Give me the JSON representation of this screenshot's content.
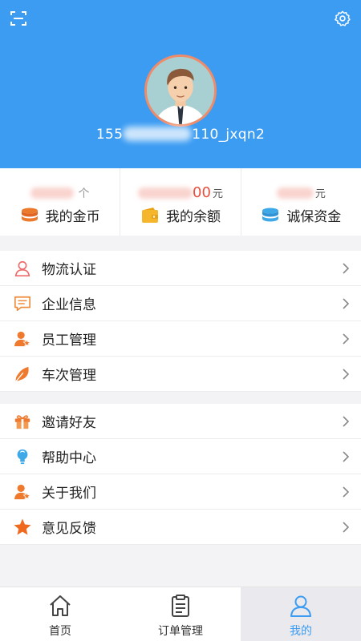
{
  "header": {
    "username_prefix": "155",
    "username_suffix": "110_jxqn2",
    "accent": "#3b9cf2"
  },
  "stats": [
    {
      "label": "我的金币",
      "value_tail": "个",
      "icon": "coin-stack-icon"
    },
    {
      "label": "我的余额",
      "value_tail": "00",
      "unit": "元",
      "icon": "wallet-icon"
    },
    {
      "label": "诚保资金",
      "value_tail": "0.00",
      "unit": "元",
      "icon": "database-icon"
    }
  ],
  "menu_group_1": [
    {
      "label": "物流认证",
      "icon": "user-outline-icon"
    },
    {
      "label": "企业信息",
      "icon": "message-list-icon"
    },
    {
      "label": "员工管理",
      "icon": "user-star-icon"
    },
    {
      "label": "车次管理",
      "icon": "leaf-icon"
    }
  ],
  "menu_group_2": [
    {
      "label": "邀请好友",
      "icon": "gift-icon"
    },
    {
      "label": "帮助中心",
      "icon": "lightbulb-icon"
    },
    {
      "label": "关于我们",
      "icon": "user-star-icon"
    },
    {
      "label": "意见反馈",
      "icon": "star-icon"
    }
  ],
  "tabs": [
    {
      "label": "首页",
      "icon": "home-icon"
    },
    {
      "label": "订单管理",
      "icon": "clipboard-icon"
    },
    {
      "label": "我的",
      "icon": "user-icon",
      "active": true
    }
  ]
}
